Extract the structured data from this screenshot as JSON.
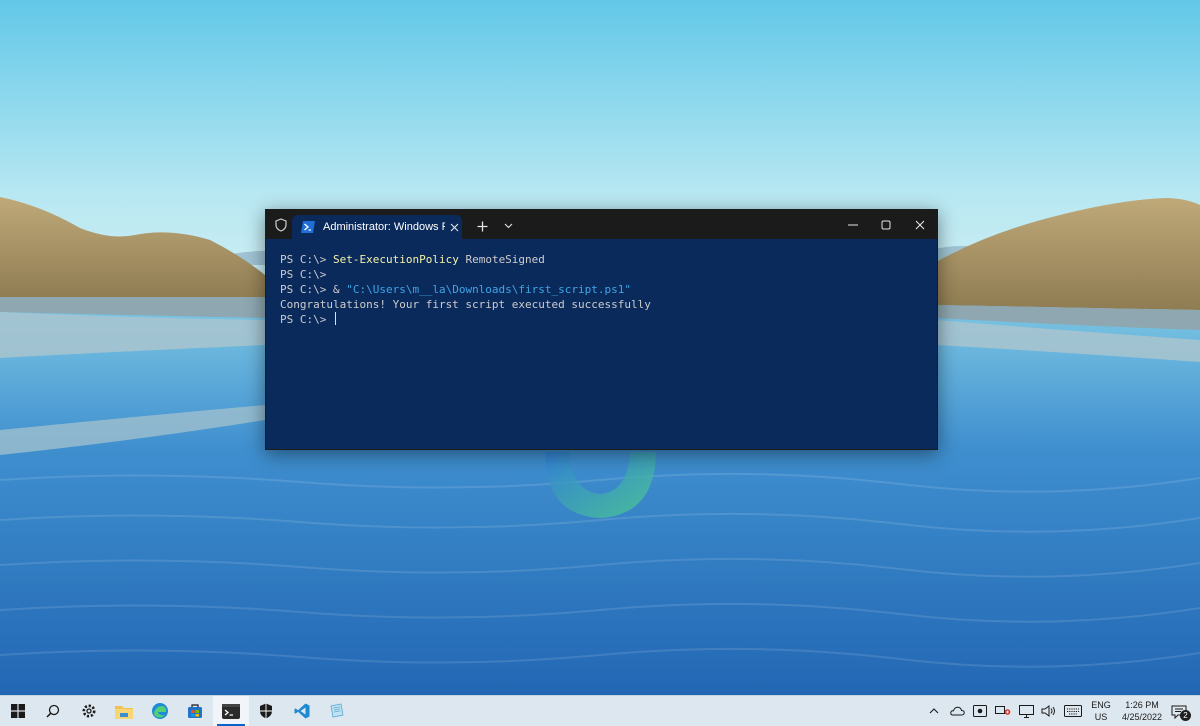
{
  "terminal": {
    "tab_title": "Administrator: Windows Powe",
    "tab_icon": "powershell-icon",
    "lines": [
      {
        "prompt": "PS C:\\> ",
        "command": "Set-ExecutionPolicy",
        "args": " RemoteSigned",
        "string": ""
      },
      {
        "prompt": "PS C:\\>",
        "command": "",
        "args": "",
        "string": ""
      },
      {
        "prompt": "PS C:\\> ",
        "command": "",
        "args": "& ",
        "string": "\"C:\\Users\\m__la\\Downloads\\first_script.ps1\""
      },
      {
        "prompt": "",
        "command": "",
        "args": "Congratulations! Your first script executed successfully",
        "string": ""
      },
      {
        "prompt": "PS C:\\> ",
        "command": "",
        "args": "",
        "string": ""
      }
    ],
    "colors": {
      "background": "#0b2a5c",
      "command": "#f5f2a8",
      "string": "#3ea5e8",
      "text": "#cccccc"
    }
  },
  "taskbar": {
    "apps": [
      "windows-start-icon",
      "search-icon",
      "settings-icon",
      "file-explorer-icon",
      "edge-icon",
      "store-icon",
      "terminal-icon",
      "security-icon",
      "vscode-icon",
      "notepad-icon"
    ],
    "active_app": "terminal-icon",
    "tray_icons": [
      "chevron-up-icon",
      "onedrive-icon",
      "screen-capture-icon",
      "share-icon",
      "network-icon",
      "volume-icon",
      "keyboard-icon"
    ],
    "language": {
      "line1": "ENG",
      "line2": "US"
    },
    "clock": {
      "time": "1:26 PM",
      "date": "4/25/2022"
    },
    "notification_count": "2"
  }
}
